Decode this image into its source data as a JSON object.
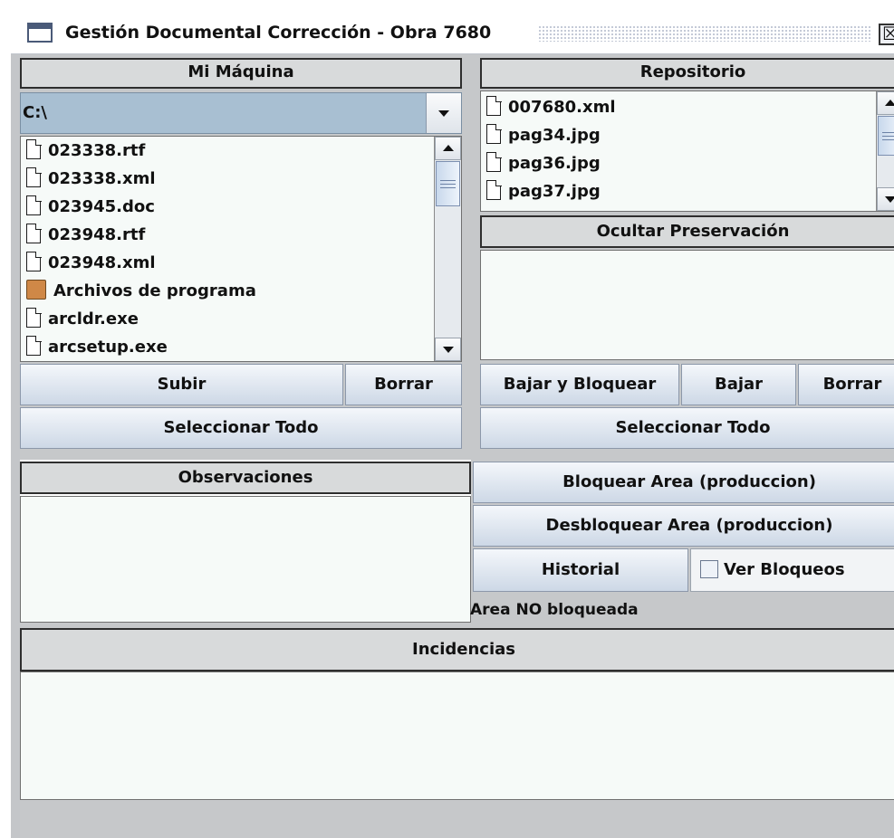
{
  "window": {
    "title": "Gestión Documental Corrección - Obra 7680",
    "close_glyph": "☒"
  },
  "local": {
    "header": "Mi Máquina",
    "drive": "C:\\",
    "files": [
      {
        "name": "023338.rtf",
        "icon": "file-icon"
      },
      {
        "name": "023338.xml",
        "icon": "file-icon"
      },
      {
        "name": "023945.doc",
        "icon": "file-icon"
      },
      {
        "name": "023948.rtf",
        "icon": "file-icon"
      },
      {
        "name": "023948.xml",
        "icon": "file-icon"
      },
      {
        "name": "Archivos de programa",
        "icon": "folder-icon"
      },
      {
        "name": "arcldr.exe",
        "icon": "file-icon"
      },
      {
        "name": "arcsetup.exe",
        "icon": "file-icon"
      }
    ],
    "upload_button": "Subir",
    "delete_button": "Borrar",
    "select_all_button": "Seleccionar Todo"
  },
  "repo": {
    "header": "Repositorio",
    "files": [
      {
        "name": "007680.xml",
        "icon": "file-icon"
      },
      {
        "name": "pag34.jpg",
        "icon": "file-icon"
      },
      {
        "name": "pag36.jpg",
        "icon": "file-icon"
      },
      {
        "name": "pag37.jpg",
        "icon": "file-icon"
      }
    ],
    "preservation_header": "Ocultar Preservación",
    "download_lock_button": "Bajar y Bloquear",
    "download_button": "Bajar",
    "delete_button": "Borrar",
    "select_all_button": "Seleccionar Todo"
  },
  "observations": {
    "header": "Observaciones"
  },
  "area": {
    "lock_button": "Bloquear Area (produccion)",
    "unlock_button": "Desbloquear Area (produccion)",
    "history_button": "Historial",
    "view_locks_label": "Ver Bloqueos",
    "view_locks_checked": false,
    "status": "Area NO bloqueada"
  },
  "incidents": {
    "header": "Incidencias"
  },
  "colors": {
    "panel": "#c6c8ca",
    "header_border": "#2e2e2e",
    "button_top": "#f4f7fb",
    "button_bottom": "#cdd8e6",
    "folder": "#cf8847"
  }
}
